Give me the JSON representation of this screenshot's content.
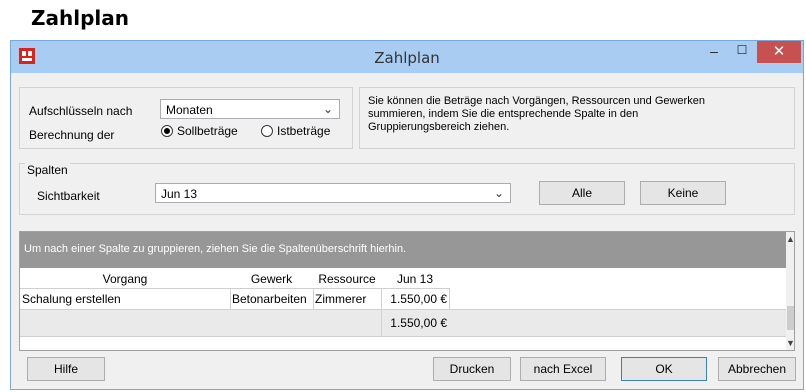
{
  "doc_title": "Zahlplan",
  "window": {
    "title": "Zahlplan",
    "minimize": "–",
    "maximize": "☐",
    "close": "✕",
    "app_icon": "app-logo-icon"
  },
  "options": {
    "aufschluesseln_label": "Aufschlüsseln nach",
    "aufschluesseln_value": "Monaten",
    "berechnung_label": "Berechnung der",
    "radio_soll": "Sollbeträge",
    "radio_ist": "Istbeträge",
    "selected": "Sollbeträge"
  },
  "info_text_line1": "Sie können die Beträge nach Vorgängen, Ressourcen und Gewerken",
  "info_text_line2": "summieren, indem Sie die entsprechende Spalte in den",
  "info_text_line3": "Gruppierungsbereich ziehen.",
  "spalten": {
    "legend": "Spalten",
    "sichtbarkeit_label": "Sichtbarkeit",
    "sichtbarkeit_value": "Jun 13",
    "alle_button": "Alle",
    "keine_button": "Keine"
  },
  "grid": {
    "group_hint": "Um nach einer Spalte zu gruppieren, ziehen Sie die Spaltenüberschrift hierhin.",
    "columns": [
      "Vorgang",
      "Gewerk",
      "Ressource",
      "Jun 13"
    ],
    "rows": [
      [
        "Schalung erstellen",
        "Betonarbeiten",
        "Zimmerer",
        "1.550,00 €"
      ]
    ],
    "total": "1.550,00 €"
  },
  "footer": {
    "hilfe": "Hilfe",
    "drucken": "Drucken",
    "excel": "nach Excel",
    "ok": "OK",
    "abbrechen": "Abbrechen"
  },
  "colors": {
    "titlebar": "#a9cdf2",
    "close": "#c75050",
    "group_bar": "#979797"
  }
}
